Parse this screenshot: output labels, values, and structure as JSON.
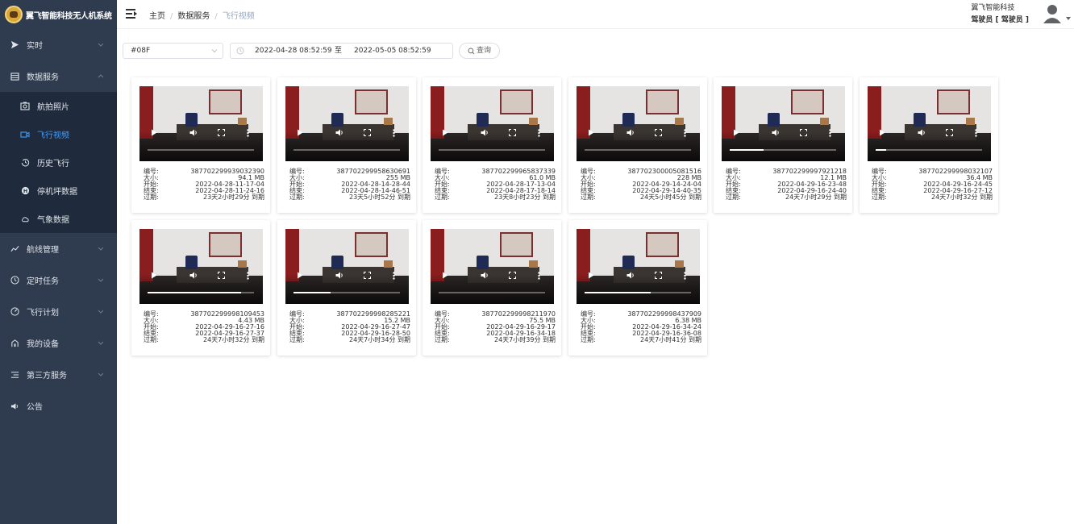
{
  "app": {
    "title": "翼飞智能科技无人机系统"
  },
  "sidebar": {
    "items": [
      {
        "label": "实时",
        "icon": "send-icon"
      },
      {
        "label": "数据服务",
        "icon": "list-icon"
      },
      {
        "label": "航线管理",
        "icon": "route-icon"
      },
      {
        "label": "定时任务",
        "icon": "clock-icon"
      },
      {
        "label": "飞行计划",
        "icon": "compass-icon"
      },
      {
        "label": "我的设备",
        "icon": "device-icon"
      },
      {
        "label": "第三方服务",
        "icon": "menu-icon"
      },
      {
        "label": "公告",
        "icon": "speaker-icon"
      }
    ],
    "sub": [
      {
        "label": "航拍照片",
        "icon": "camera-icon"
      },
      {
        "label": "飞行视频",
        "icon": "video-icon"
      },
      {
        "label": "历史飞行",
        "icon": "history-icon"
      },
      {
        "label": "停机坪数据",
        "icon": "helipad-icon"
      },
      {
        "label": "气象数据",
        "icon": "weather-icon"
      }
    ]
  },
  "header": {
    "breadcrumb": [
      "主页",
      "数据服务",
      "飞行视频"
    ],
    "company": "翼飞智能科技",
    "role": "驾驶员 [ 驾驶员 ]"
  },
  "filters": {
    "device": "#08F",
    "start": "2022-04-28 08:52:59",
    "separator": "至",
    "end": "2022-05-05 08:52:59",
    "query_label": "查询"
  },
  "labels": {
    "id": "编号:",
    "size": "大小:",
    "start": "开始:",
    "end": "结束:",
    "expire": "过期:"
  },
  "videos": [
    {
      "id": "387702299939032390",
      "size": "94.1 MB",
      "start": "2022-04-28-11-17-04",
      "end": "2022-04-28-11-24-16",
      "expire": "23天2小时29分 到期",
      "progress": 0.0
    },
    {
      "id": "387702299958630691",
      "size": "255 MB",
      "start": "2022-04-28-14-28-44",
      "end": "2022-04-28-14-46-51",
      "expire": "23天5小时52分 到期",
      "progress": 0.0
    },
    {
      "id": "387702299965837339",
      "size": "61.0 MB",
      "start": "2022-04-28-17-13-04",
      "end": "2022-04-28-17-18-14",
      "expire": "23天8小时23分 到期",
      "progress": 0.0
    },
    {
      "id": "387702300005081516",
      "size": "228 MB",
      "start": "2022-04-29-14-24-04",
      "end": "2022-04-29-14-40-35",
      "expire": "24天5小时45分 到期",
      "progress": 0.0
    },
    {
      "id": "387702299997921218",
      "size": "12.1 MB",
      "start": "2022-04-29-16-23-48",
      "end": "2022-04-29-16-24-40",
      "expire": "24天7小时29分 到期",
      "progress": 0.32
    },
    {
      "id": "387702299998032107",
      "size": "36.4 MB",
      "start": "2022-04-29-16-24-45",
      "end": "2022-04-29-16-27-12",
      "expire": "24天7小时32分 到期",
      "progress": 0.1
    },
    {
      "id": "387702299998109453",
      "size": "4.43 MB",
      "start": "2022-04-29-16-27-16",
      "end": "2022-04-29-16-27-37",
      "expire": "24天7小时32分 到期",
      "progress": 0.88
    },
    {
      "id": "387702299998285221",
      "size": "15.2 MB",
      "start": "2022-04-29-16-27-47",
      "end": "2022-04-29-16-28-50",
      "expire": "24天7小时34分 到期",
      "progress": 0.35
    },
    {
      "id": "387702299998211970",
      "size": "75.5 MB",
      "start": "2022-04-29-16-29-17",
      "end": "2022-04-29-16-34-18",
      "expire": "24天7小时39分 到期",
      "progress": 0.0
    },
    {
      "id": "387702299998437909",
      "size": "6.38 MB",
      "start": "2022-04-29-16-34-24",
      "end": "2022-04-29-16-36-08",
      "expire": "24天7小时41分 到期",
      "progress": 0.62
    }
  ]
}
